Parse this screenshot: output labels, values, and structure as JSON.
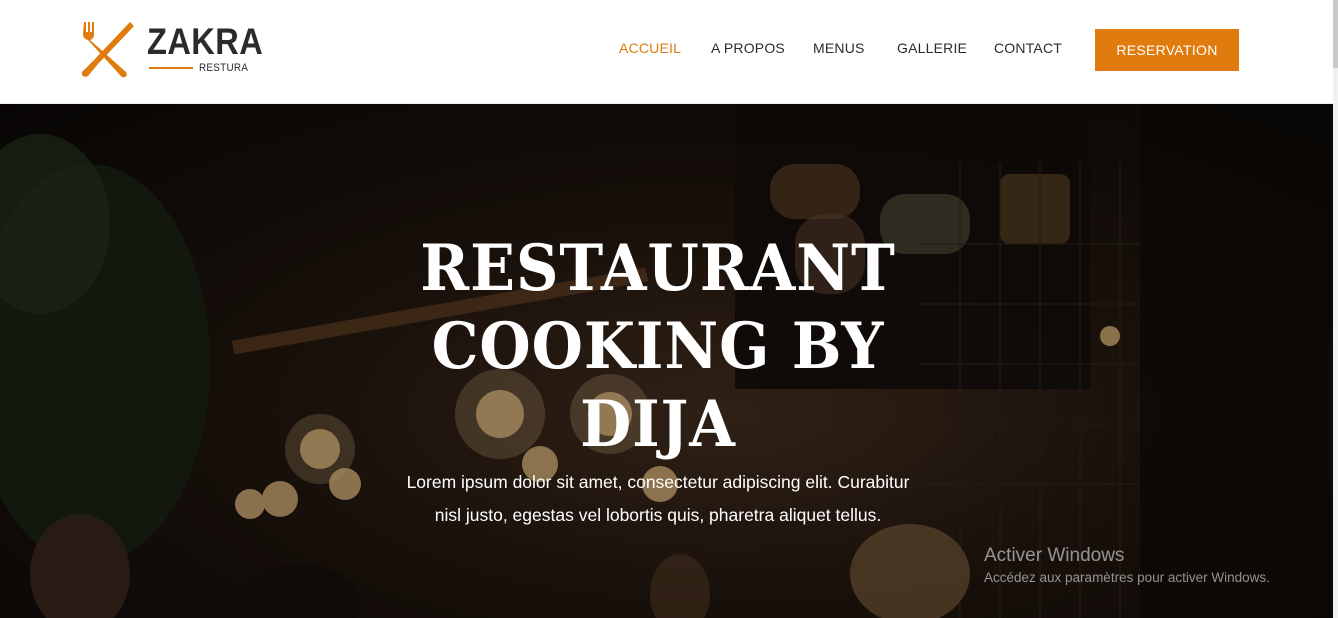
{
  "brand": {
    "name": "ZAKRA",
    "tagline": "RESTURA",
    "accent": "#e07b0d"
  },
  "nav": {
    "items": [
      {
        "label": "ACCUEIL",
        "active": true
      },
      {
        "label": "A PROPOS",
        "active": false
      },
      {
        "label": "MENUS",
        "active": false
      },
      {
        "label": "GALLERIE",
        "active": false
      },
      {
        "label": "CONTACT",
        "active": false
      }
    ],
    "cta_label": "RESERVATION"
  },
  "hero": {
    "title_line1": "RESTAURANT",
    "title_line2": "COOKING BY",
    "title_line3": "DIJA",
    "text": "Lorem ipsum dolor sit amet, consectetur adipiscing elit. Curabitur nisl justo, egestas vel lobortis quis, pharetra aliquet tellus."
  },
  "watermark": {
    "title": "Activer Windows",
    "subtitle": "Accédez aux paramètres pour activer Windows."
  },
  "icons": {
    "logo": "fork-knife-icon"
  }
}
